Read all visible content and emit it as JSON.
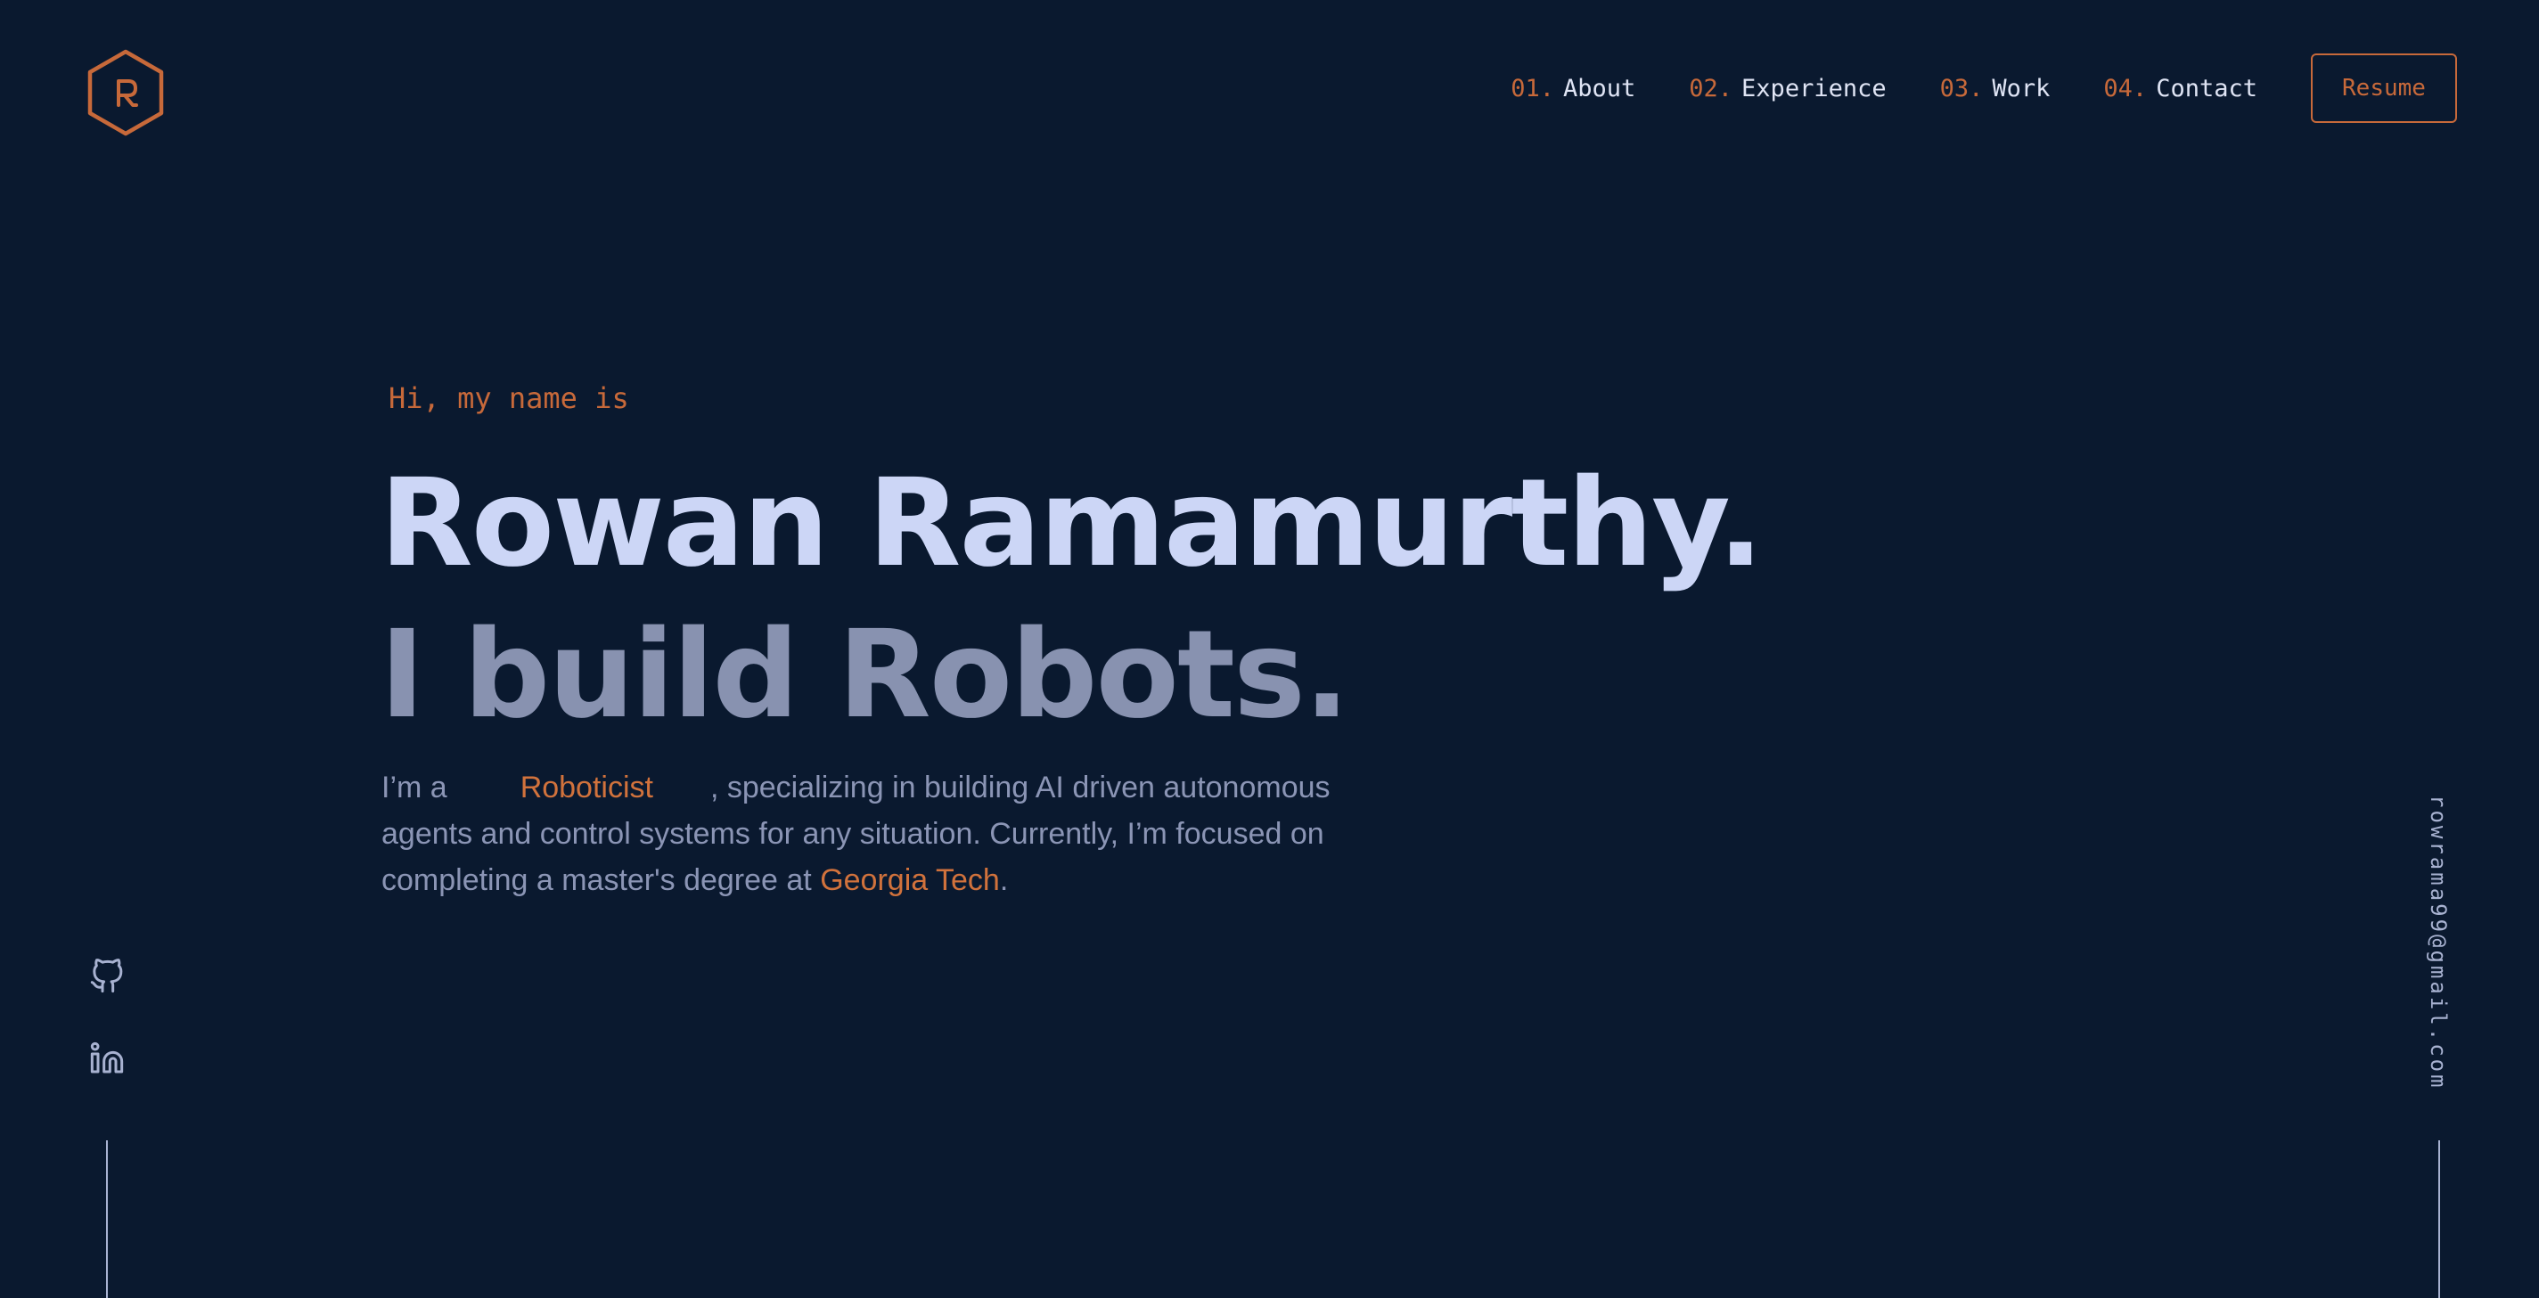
{
  "logo": {
    "letter": "R",
    "color": "#c7693a"
  },
  "nav": {
    "items": [
      {
        "num": "01.",
        "label": "About"
      },
      {
        "num": "02.",
        "label": "Experience"
      },
      {
        "num": "03.",
        "label": "Work"
      },
      {
        "num": "04.",
        "label": "Contact"
      }
    ],
    "resume_label": "Resume"
  },
  "hero": {
    "greeting": "Hi, my name is",
    "name": "Rowan Ramamurthy.",
    "tagline": "I build Robots.",
    "desc_prefix": "I’m a",
    "role": "Roboticist",
    "desc_middle": ", specializing in building AI driven autonomous agents and control systems for any situation. Currently, I’m focused on completing a master's degree at",
    "school": "Georgia Tech",
    "desc_suffix": "."
  },
  "social": {
    "icons": [
      "github-icon",
      "linkedin-icon"
    ]
  },
  "email": "rowrama99@gmail.com",
  "colors": {
    "background": "#0a192f",
    "accent": "#c7693a",
    "heading": "#ccd6f6",
    "subheading": "#8892b0",
    "text": "#8b95b5"
  }
}
